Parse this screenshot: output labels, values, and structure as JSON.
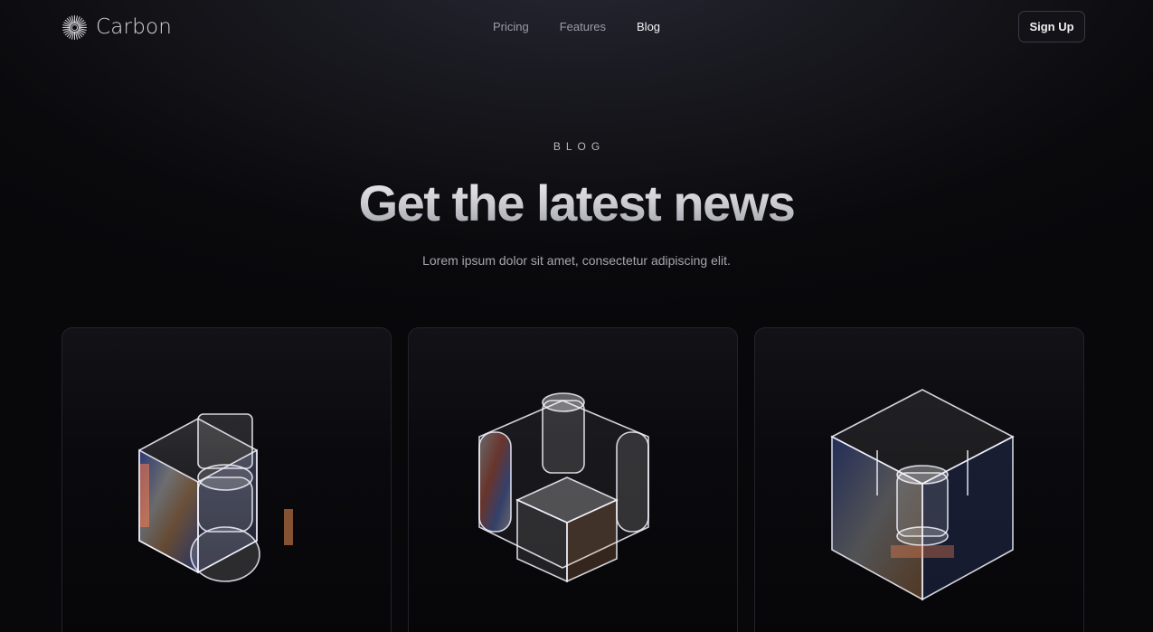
{
  "brand": {
    "name": "Carbon",
    "logo_icon": "radial-burst-icon"
  },
  "nav": {
    "links": [
      {
        "label": "Pricing",
        "active": false
      },
      {
        "label": "Features",
        "active": false
      },
      {
        "label": "Blog",
        "active": true
      }
    ],
    "signup_label": "Sign Up"
  },
  "hero": {
    "eyebrow": "BLOG",
    "headline": "Get the latest news",
    "subtitle": "Lorem ipsum dolor sit amet, consectetur adipiscing elit."
  },
  "cards": [
    {
      "image": "glass-cube-cross-icon"
    },
    {
      "image": "glass-cube-pillar-icon"
    },
    {
      "image": "glass-cube-frame-icon"
    }
  ],
  "colors": {
    "background": "#08080b",
    "text": "#e8e8ec",
    "muted": "#9c9ca6",
    "border": "#22222a"
  }
}
